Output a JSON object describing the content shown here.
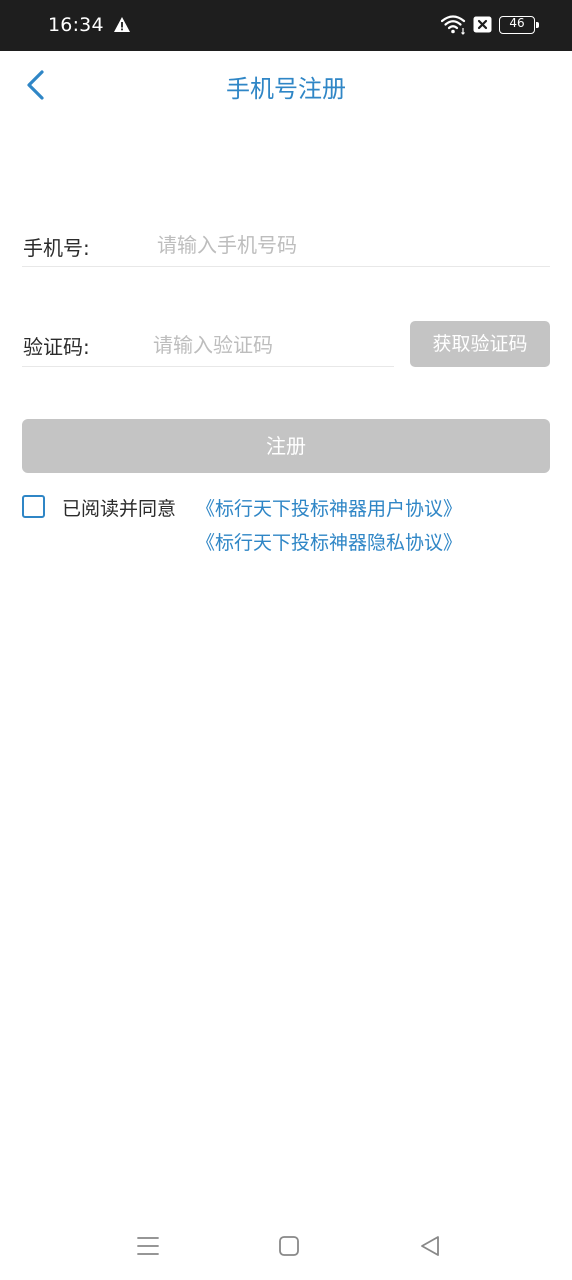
{
  "status_bar": {
    "time": "16:34",
    "battery": "46",
    "icons": [
      "warning-icon",
      "wifi-icon",
      "sim-disabled-icon",
      "battery-icon"
    ]
  },
  "header": {
    "title": "手机号注册",
    "back_icon": "chevron-left-icon",
    "accent_color": "#2f86c6"
  },
  "form": {
    "phone": {
      "label": "手机号:",
      "value": "",
      "placeholder": "请输入手机号码"
    },
    "code": {
      "label": "验证码:",
      "value": "",
      "placeholder": "请输入验证码",
      "get_code_label": "获取验证码"
    },
    "submit_label": "注册",
    "disabled_color": "#c4c4c4"
  },
  "agreement": {
    "checked": false,
    "prefix": "已阅读并同意",
    "user_agreement": "《标行天下投标神器用户协议》",
    "privacy_agreement": "《标行天下投标神器隐私协议》"
  },
  "nav_bar": {
    "icons": [
      "menu-icon",
      "home-icon",
      "back-icon"
    ]
  }
}
